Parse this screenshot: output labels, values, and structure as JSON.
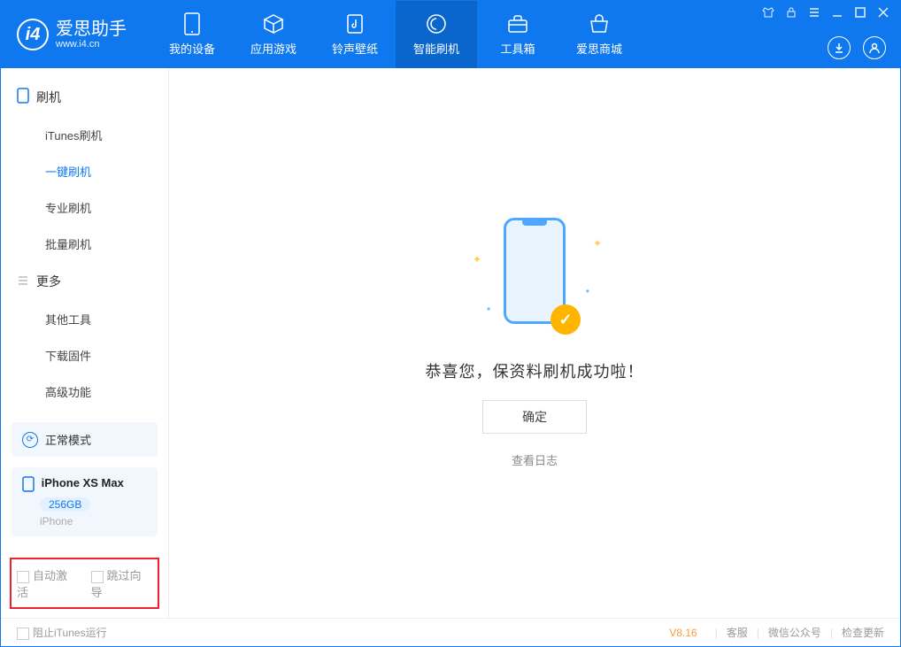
{
  "app": {
    "title": "爱思助手",
    "site": "www.i4.cn"
  },
  "nav": {
    "items": [
      {
        "label": "我的设备",
        "icon": "device"
      },
      {
        "label": "应用游戏",
        "icon": "cube"
      },
      {
        "label": "铃声壁纸",
        "icon": "music"
      },
      {
        "label": "智能刷机",
        "icon": "shield"
      },
      {
        "label": "工具箱",
        "icon": "toolbox"
      },
      {
        "label": "爱思商城",
        "icon": "store"
      }
    ],
    "active_index": 3
  },
  "sidebar": {
    "group1": {
      "title": "刷机",
      "items": [
        "iTunes刷机",
        "一键刷机",
        "专业刷机",
        "批量刷机"
      ],
      "active_index": 1
    },
    "group2": {
      "title": "更多",
      "items": [
        "其他工具",
        "下载固件",
        "高级功能"
      ]
    },
    "mode": {
      "label": "正常模式"
    },
    "device": {
      "name": "iPhone XS Max",
      "storage": "256GB",
      "type": "iPhone"
    },
    "options": {
      "auto_activate": "自动激活",
      "skip_guide": "跳过向导"
    }
  },
  "main": {
    "success_text": "恭喜您，保资料刷机成功啦！",
    "ok_label": "确定",
    "log_link": "查看日志"
  },
  "footer": {
    "block_itunes": "阻止iTunes运行",
    "version": "V8.16",
    "links": [
      "客服",
      "微信公众号",
      "检查更新"
    ]
  }
}
